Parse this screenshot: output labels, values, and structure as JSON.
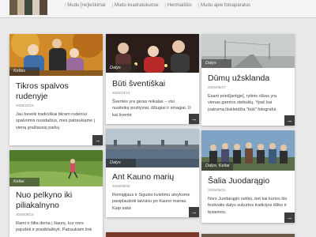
{
  "nav": {
    "items": [
      "Mudu [ne]ieškimai",
      "Mudu kvadratukuose",
      "Hermiaiškis",
      "Mudu apie fotoaparatus"
    ]
  },
  "cards": [
    {
      "tag": "Kelias",
      "title": "Tikros spalvos rudenyje",
      "date": "2025/10/18",
      "excerpt": "Jau beveik tradiciškai tikram rudeniui spalvomis nusidažius, mes patraukiame į vieną gražiausių parkų",
      "more_icon": "→"
    },
    {
      "tag": "Dalys",
      "title": "Būti šventiškai",
      "date": "2025/10/15",
      "excerpt": "Šventės yra geras reikalas – visi nusiteikę pozityviai, džiugiai ir smagiai. O kai šventė",
      "more_icon": "→"
    },
    {
      "tag": "Dalys",
      "title": "Dūmų užsklanda",
      "date": "2025/09/27",
      "excerpt": "Esant prieš[antgje], rytinis rūkas yra vienas gamtos stebuklų. Ypač kai įvairumą išskleidžia \"būti\" fotografui",
      "more_icon": "→"
    },
    {
      "tag": "Dalys",
      "title": "Ant Kauno marių",
      "date": "2025/09/08",
      "excerpt": "Remigijaus ir Sigutės kvietimu atvykome pasiplaukioti laivukiu po Kauno marias. Kaip sakė",
      "more_icon": "→"
    },
    {
      "tag": "Dalys, Keliai",
      "title": "Šalia Juodarągio",
      "date": "2025/09/24",
      "excerpt": "Nors Juodarągio neliko, bet kai kurios šio festivalio dalys sukurtos tradicijos išliko ir tęsiamos.",
      "more_icon": "→"
    },
    {
      "tag": "Keliai",
      "title": "Nuo pelkyno iki piliakalnyno",
      "date": "2025/08/10",
      "excerpt": "Rami ir šilta diena į šiaurę, kur nors pajudėti ir prasiblaškyti. Patraukiam link",
      "more_icon": "→"
    }
  ]
}
